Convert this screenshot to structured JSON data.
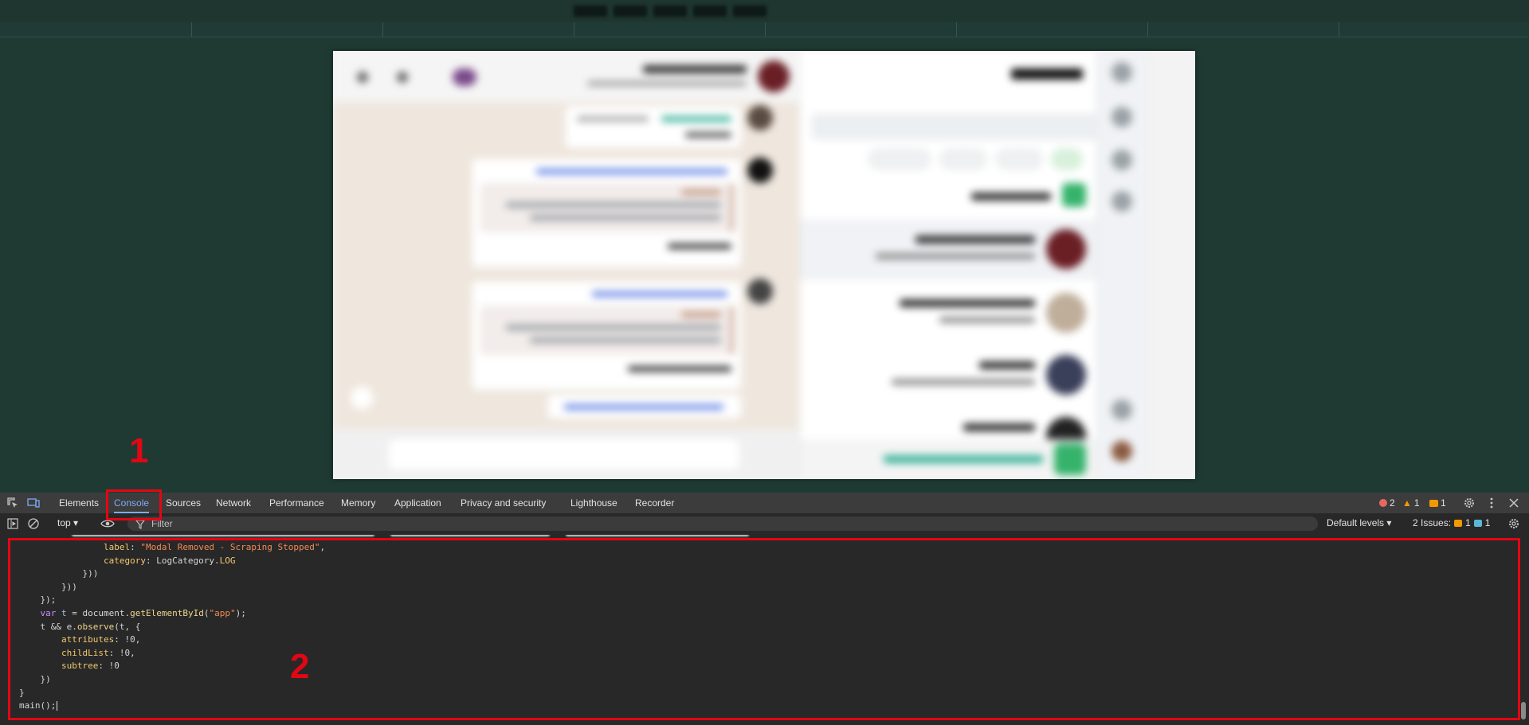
{
  "devtools": {
    "tabs": [
      {
        "label": "Elements"
      },
      {
        "label": "Console"
      },
      {
        "label": "Sources"
      },
      {
        "label": "Network"
      },
      {
        "label": "Performance"
      },
      {
        "label": "Memory"
      },
      {
        "label": "Application"
      },
      {
        "label": "Privacy and security"
      },
      {
        "label": "Lighthouse"
      },
      {
        "label": "Recorder"
      }
    ],
    "active_tab": "Console",
    "errors_count": "2",
    "warnings_count": "1",
    "info_count": "1",
    "context_select": "top",
    "filter_placeholder": "Filter",
    "levels_select": "Default levels",
    "issues_label": "2 Issues:",
    "issues_warn": "1",
    "issues_info": "1",
    "colors": {
      "error": "#e46962",
      "warning": "#f29900",
      "info": "#7cacf8",
      "issue_info": "#5bb8d4"
    }
  },
  "console": {
    "lines": [
      {
        "indent": "                ",
        "parts": [
          [
            "p",
            "label"
          ],
          [
            "t",
            ": "
          ],
          [
            "s",
            "\"Modal Removed - Scraping Stopped\""
          ],
          [
            "t",
            ","
          ]
        ]
      },
      {
        "indent": "                ",
        "parts": [
          [
            "p",
            "category"
          ],
          [
            "t",
            ": LogCategory."
          ],
          [
            "p",
            "LOG"
          ]
        ]
      },
      {
        "indent": "            ",
        "parts": [
          [
            "t",
            "}))"
          ]
        ]
      },
      {
        "indent": "        ",
        "parts": [
          [
            "t",
            "}))"
          ]
        ]
      },
      {
        "indent": "    ",
        "parts": [
          [
            "t",
            "});"
          ]
        ]
      },
      {
        "indent": "    ",
        "parts": [
          [
            "k",
            "var"
          ],
          [
            "t",
            " "
          ],
          [
            "n",
            "t"
          ],
          [
            "t",
            " = document."
          ],
          [
            "f",
            "getElementById"
          ],
          [
            "t",
            "("
          ],
          [
            "s",
            "\"app\""
          ],
          [
            "t",
            ");"
          ]
        ]
      },
      {
        "indent": "    ",
        "parts": [
          [
            "t",
            "t && e."
          ],
          [
            "f",
            "observe"
          ],
          [
            "t",
            "(t, {"
          ]
        ]
      },
      {
        "indent": "        ",
        "parts": [
          [
            "p",
            "attributes"
          ],
          [
            "t",
            ": !0,"
          ]
        ]
      },
      {
        "indent": "        ",
        "parts": [
          [
            "p",
            "childList"
          ],
          [
            "t",
            ": !0,"
          ]
        ]
      },
      {
        "indent": "        ",
        "parts": [
          [
            "p",
            "subtree"
          ],
          [
            "t",
            ": !0"
          ]
        ]
      },
      {
        "indent": "    ",
        "parts": [
          [
            "t",
            "})"
          ]
        ]
      },
      {
        "indent": "",
        "parts": [
          [
            "t",
            "}"
          ]
        ]
      },
      {
        "indent": "",
        "parts": [
          [
            "t",
            "main();"
          ]
        ]
      }
    ]
  },
  "annotations": {
    "marker_1": "1",
    "marker_2": "2",
    "color": "#e30613"
  }
}
